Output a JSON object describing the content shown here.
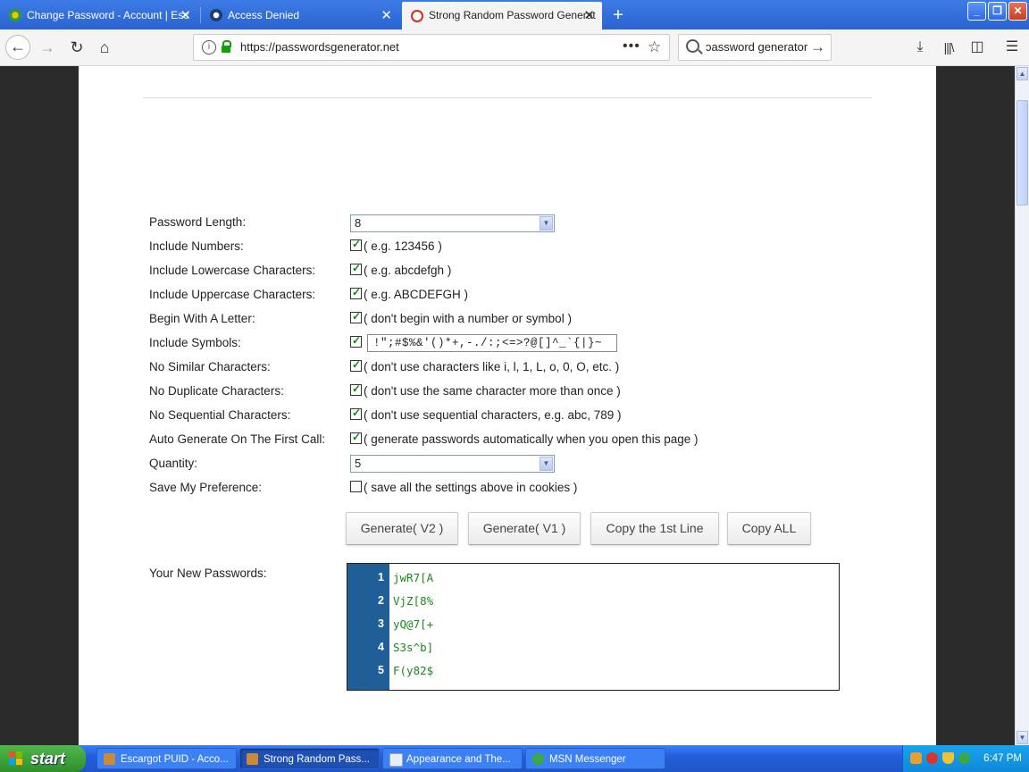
{
  "browser": {
    "tabs": [
      {
        "title": "Change Password - Account | Esc"
      },
      {
        "title": "Access Denied"
      },
      {
        "title": "Strong Random Password Generat"
      }
    ],
    "new_tab_symbol": "+",
    "url": "https://passwordsgenerator.net",
    "search_text": "ɔassword generator",
    "icons": [
      "back-icon",
      "forward-icon",
      "reload-icon",
      "home-icon",
      "info-icon",
      "lock-icon",
      "page-actions-icon",
      "bookmark-star-icon",
      "search-icon",
      "go-arrow-icon",
      "downloads-icon",
      "library-icon",
      "sidebar-icon",
      "menu-icon"
    ]
  },
  "form": {
    "rows": [
      {
        "label": "Password Length:",
        "type": "select",
        "value": "8"
      },
      {
        "label": "Include Numbers:",
        "type": "checkbox",
        "checked": true,
        "desc": "( e.g. 123456 )"
      },
      {
        "label": "Include Lowercase Characters:",
        "type": "checkbox",
        "checked": true,
        "desc": "( e.g. abcdefgh )"
      },
      {
        "label": "Include Uppercase Characters:",
        "type": "checkbox",
        "checked": true,
        "desc": "( e.g. ABCDEFGH )"
      },
      {
        "label": "Begin With A Letter:",
        "type": "checkbox",
        "checked": true,
        "desc": "( don't begin with a number or symbol )"
      },
      {
        "label": "Include Symbols:",
        "type": "checkbox-input",
        "checked": true,
        "value": "!\";#$%&'()*+,-./:;<=>?@[]^_`{|}~"
      },
      {
        "label": "No Similar Characters:",
        "type": "checkbox",
        "checked": true,
        "desc": "( don't use characters like i, l, 1, L, o, 0, O, etc. )"
      },
      {
        "label": "No Duplicate Characters:",
        "type": "checkbox",
        "checked": true,
        "desc": "( don't use the same character more than once )"
      },
      {
        "label": "No Sequential Characters:",
        "type": "checkbox",
        "checked": true,
        "desc": "( don't use sequential characters, e.g. abc, 789 )"
      },
      {
        "label": "Auto Generate On The First Call:",
        "type": "checkbox",
        "checked": true,
        "desc": "( generate passwords automatically when you open this page )"
      },
      {
        "label": "Quantity:",
        "type": "select",
        "value": "5"
      },
      {
        "label": "Save My Preference:",
        "type": "checkbox",
        "checked": false,
        "desc": "( save all the settings above in cookies )"
      }
    ],
    "buttons": {
      "generate_v2": "Generate( V2 )",
      "generate_v1": "Generate( V1 )",
      "copy_first": "Copy the 1st Line",
      "copy_all": "Copy ALL"
    },
    "results_label": "Your New Passwords:",
    "passwords": [
      {
        "n": "1",
        "value": "jwR7[A"
      },
      {
        "n": "2",
        "value": "VjZ[8%"
      },
      {
        "n": "3",
        "value": "yQ@7[+"
      },
      {
        "n": "4",
        "value": "S3s^b]"
      },
      {
        "n": "5",
        "value": "F(y82$"
      }
    ]
  },
  "taskbar": {
    "start_label": "start",
    "tasks": [
      {
        "label": "Escargot PUID - Acco..."
      },
      {
        "label": "Strong Random Pass..."
      },
      {
        "label": "Appearance and The..."
      },
      {
        "label": "MSN Messenger"
      }
    ],
    "clock": "6:47 PM"
  },
  "colors": {
    "firefox_tab_blue": "#2a64d1",
    "password_green": "#1a8a1a",
    "gutter_blue": "#1f5e96",
    "xp_taskbar": "#245edb",
    "xp_start_green": "#3a9c35"
  }
}
